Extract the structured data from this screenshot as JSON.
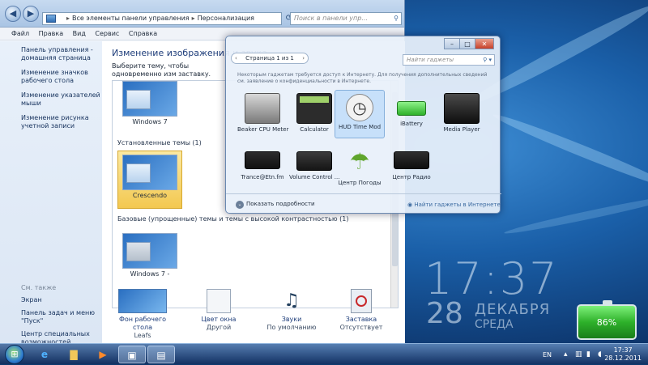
{
  "explorer": {
    "address_segments": [
      "Все элементы панели управления",
      "Персонализация"
    ],
    "search_placeholder": "Поиск в панели упр...",
    "menu": [
      "Файл",
      "Правка",
      "Вид",
      "Сервис",
      "Справка"
    ],
    "left_links": [
      "Панель управления - домашняя страница",
      "Изменение значков рабочего стола",
      "Изменение указателей мыши",
      "Изменение рисунка учетной записи"
    ],
    "see_also_header": "См. также",
    "see_also_links": [
      "Экран",
      "Панель задач и меню \"Пуск\"",
      "Центр специальных возможностей"
    ],
    "heading": "Изменение изображения и звука",
    "description": "Выберите тему, чтобы одновременно изм заставку.",
    "themes_top": [
      {
        "name": "Windows 7"
      }
    ],
    "group_installed": "Установленные темы (1)",
    "themes_installed": [
      {
        "name": "Crescendo"
      }
    ],
    "group_basic": "Базовые (упрощенные) темы и темы с высокой контрастностью (1)",
    "themes_basic": [
      {
        "name": "Windows 7 -"
      }
    ],
    "bottom_items": [
      {
        "title": "Фон рабочего стола",
        "value": "Leafs"
      },
      {
        "title": "Цвет окна",
        "value": "Другой"
      },
      {
        "title": "Звуки",
        "value": "По умолчанию"
      },
      {
        "title": "Заставка",
        "value": "Отсутствует"
      }
    ]
  },
  "gallery": {
    "pager_text": "Страница 1 из 1",
    "search_placeholder": "Найти гаджеты",
    "note": "Некоторым гаджетам требуется доступ к Интернету. Для получения дополнительных сведений см. заявление о конфиденциальности в Интернете.",
    "gadgets_row1": [
      {
        "label": "Beaker CPU Meter",
        "icon": "beaker-cpu-meter-icon"
      },
      {
        "label": "Calculator",
        "icon": "calculator-icon"
      },
      {
        "label": "HUD Time Mod",
        "icon": "clock-icon"
      },
      {
        "label": "iBattery",
        "icon": "battery-icon"
      },
      {
        "label": "Media Player",
        "icon": "media-player-icon"
      }
    ],
    "gadgets_row2": [
      {
        "label": "Trance@Etn.fm",
        "icon": "radio-icon"
      },
      {
        "label": "Volume Control ...",
        "icon": "volume-control-icon"
      },
      {
        "label": "Центр Погоды",
        "icon": "umbrella-icon"
      },
      {
        "label": "Центр Радио",
        "icon": "radio-center-icon"
      }
    ],
    "show_details": "Показать подробности",
    "online_link": "Найти гаджеты в Интернете"
  },
  "desktop": {
    "clock_time": "17:37",
    "clock_day": "28",
    "clock_month": "ДЕКАБРЯ",
    "clock_weekday": "СРЕДА",
    "battery_percent": "86%"
  },
  "taskbar": {
    "lang": "EN",
    "time": "17:37",
    "date": "28.12.2011"
  },
  "colors": {
    "accent_orange": "#e57c1c",
    "selection_gold": "#f3c850",
    "battery_green": "#2eb12a"
  }
}
